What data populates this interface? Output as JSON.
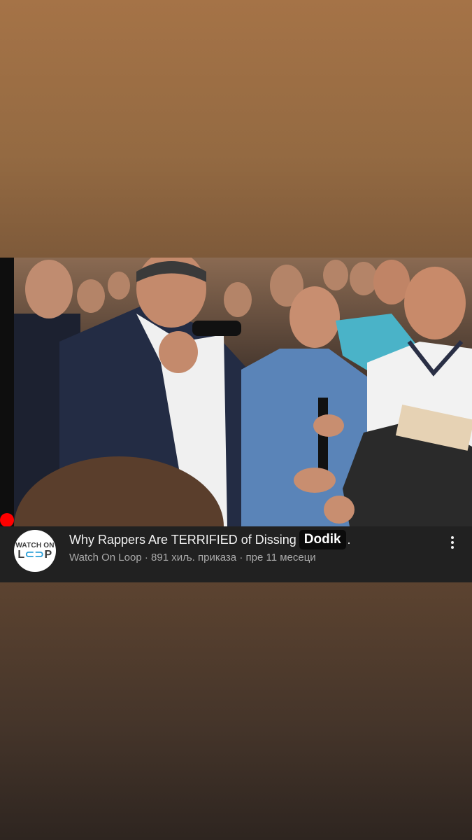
{
  "video": {
    "title": "Why Rappers Are TERRIFIED of Dissing",
    "title_highlight": "Dodik",
    "title_end": ".",
    "channel_name": "Watch On Loop",
    "views": "891 хиљ. приказа",
    "age": "пре 11 месеци",
    "separator": "·"
  },
  "avatar": {
    "line1": "WATCH ON",
    "line2_a": "L",
    "line2_b": "⊂⊃",
    "line2_c": "P"
  },
  "icons": {
    "more": "more-vertical-icon"
  },
  "colors": {
    "progress": "#ff0000",
    "card_bg": "#212121",
    "title_text": "#f1f1f1",
    "meta_text": "#aaaaaa",
    "loop_accent": "#2a9fd8"
  }
}
